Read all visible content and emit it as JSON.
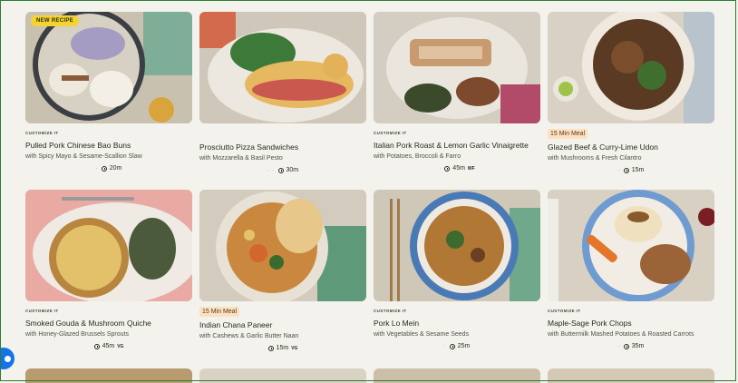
{
  "badges": {
    "new_recipe": "NEW RECIPE"
  },
  "tags": {
    "customize": "CUSTOMIZE IT",
    "min15": "15 Min Meal"
  },
  "cards": [
    {
      "title": "Pulled Pork Chinese Bao Buns",
      "subtitle": "with Spicy Mayo & Sesame-Scallion Slaw",
      "time": "20m",
      "diet": ""
    },
    {
      "title": "Prosciutto Pizza Sandwiches",
      "subtitle": "with Mozzarella & Basil Pesto",
      "time": "30m",
      "diet": ""
    },
    {
      "title": "Italian Pork Roast & Lemon Garlic Vinaigrette",
      "subtitle": "with Potatoes, Broccoli & Farro",
      "time": "45m",
      "diet": "WF"
    },
    {
      "title": "Glazed Beef & Curry-Lime Udon",
      "subtitle": "with Mushrooms & Fresh Cilantro",
      "time": "15m",
      "diet": ""
    },
    {
      "title": "Smoked Gouda & Mushroom Quiche",
      "subtitle": "with Honey-Glazed Brussels Sprouts",
      "time": "45m",
      "diet": "VG"
    },
    {
      "title": "Indian Chana Paneer",
      "subtitle": "with Cashews & Garlic Butter Naan",
      "time": "15m",
      "diet": "VG"
    },
    {
      "title": "Pork Lo Mein",
      "subtitle": "with Vegetables & Sesame Seeds",
      "time": "25m",
      "diet": ""
    },
    {
      "title": "Maple-Sage Pork Chops",
      "subtitle": "with Buttermilk Mashed Potatoes & Roasted Carrots",
      "time": "35m",
      "diet": ""
    }
  ],
  "colors": {
    "accent_badge": "#f6d330",
    "min_tag": "#fbe1c2",
    "chat": "#1473e6",
    "frame": "#2e7d32"
  }
}
